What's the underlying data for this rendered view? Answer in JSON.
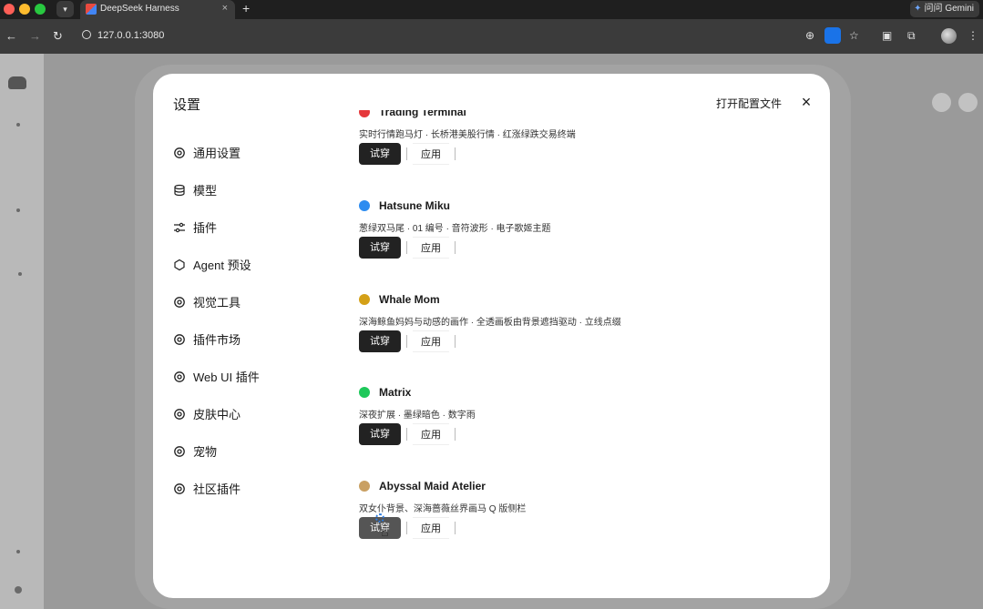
{
  "browser": {
    "tab_title": "DeepSeek Harness",
    "tab_close": "×",
    "new_tab": "+",
    "url": "127.0.0.1:3080",
    "gemini_label": "问问 Gemini",
    "nav_back": "←",
    "nav_forward": "→",
    "nav_reload": "↻"
  },
  "modal": {
    "title": "设置",
    "open_config_label": "打开配置文件",
    "close_label": "×",
    "nav_items": [
      {
        "label": "通用设置",
        "icon": "gear-icon"
      },
      {
        "label": "模型",
        "icon": "database-icon"
      },
      {
        "label": "插件",
        "icon": "sliders-icon"
      },
      {
        "label": "Agent 预设",
        "icon": "agent-icon"
      },
      {
        "label": "视觉工具",
        "icon": "gear-icon"
      },
      {
        "label": "插件市场",
        "icon": "gear-icon"
      },
      {
        "label": "Web UI 插件",
        "icon": "gear-icon"
      },
      {
        "label": "皮肤中心",
        "icon": "gear-icon"
      },
      {
        "label": "宠物",
        "icon": "gear-icon"
      },
      {
        "label": "社区插件",
        "icon": "gear-icon"
      }
    ],
    "skins": [
      {
        "name": "Trading Terminal",
        "color": "#e5383b",
        "desc": "实时行情跑马灯 · 长桥港美股行情 · 红涨绿跌交易终端",
        "try_label": "试穿",
        "apply_label": "应用"
      },
      {
        "name": "Hatsune Miku",
        "color": "#2d8cf0",
        "desc": "葱绿双马尾 · 01 编号 · 音符波形 · 电子歌姬主题",
        "try_label": "试穿",
        "apply_label": "应用"
      },
      {
        "name": "Whale Mom",
        "color": "#d4a017",
        "desc": "深海鲸鱼妈妈与动感的画作 · 全透画板由背景遮挡驱动 · 立线点缀",
        "try_label": "试穿",
        "apply_label": "应用"
      },
      {
        "name": "Matrix",
        "color": "#1ec85a",
        "desc": "深夜扩展 · 墨绿暗色 · 数字雨",
        "try_label": "试穿",
        "apply_label": "应用"
      },
      {
        "name": "Abyssal Maid Atelier",
        "color": "#c9a063",
        "desc": "双女仆背景、深海蔷薇丝界画马 Q 版侧栏",
        "try_label": "试穿",
        "apply_label": "应用"
      }
    ]
  }
}
